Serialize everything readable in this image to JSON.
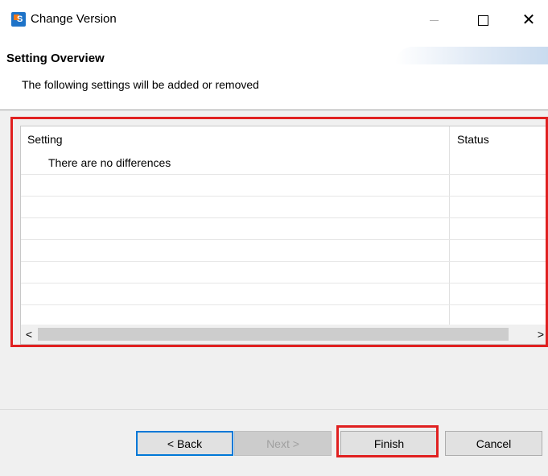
{
  "window": {
    "title": "Change Version",
    "icon": "app-s-icon",
    "controls": {
      "minimize": "minimize-icon",
      "maximize": "maximize-icon",
      "close": "close-icon"
    }
  },
  "header": {
    "title": "Setting Overview",
    "description": "The following settings will be added or removed"
  },
  "table": {
    "columns": [
      "Setting",
      "Status"
    ],
    "empty_message": "There are no differences",
    "scroll_left": "<",
    "scroll_right": ">"
  },
  "buttons": {
    "back": "< Back",
    "next": "Next >",
    "finish": "Finish",
    "cancel": "Cancel"
  },
  "colors": {
    "highlight": "#e02020",
    "focus": "#0078d7"
  }
}
